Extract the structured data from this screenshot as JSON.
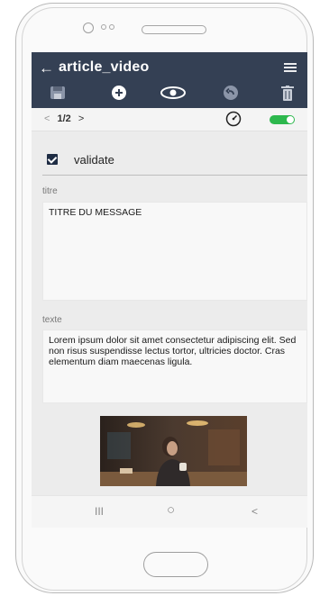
{
  "app": {
    "title": "article_video",
    "toolbar_icons": [
      "save-icon",
      "add-icon",
      "eye-icon",
      "undo-icon",
      "delete-icon"
    ],
    "accent_color": "#344054",
    "toggle_color": "#2db84d"
  },
  "nav": {
    "prev": "<",
    "page": "1/2",
    "next": ">"
  },
  "validate": {
    "label": "validate",
    "checked": true
  },
  "titre": {
    "label": "titre",
    "value": "TITRE DU MESSAGE"
  },
  "texte": {
    "label": "texte",
    "value": "Lorem ipsum dolor sit amet consectetur adipiscing elit. Sed non risus suspendisse lectus tortor, ultricies doctor. Cras elementum diam maecenas ligula."
  },
  "bottom_nav": {
    "recent": "III",
    "home": "○",
    "back": "<"
  }
}
